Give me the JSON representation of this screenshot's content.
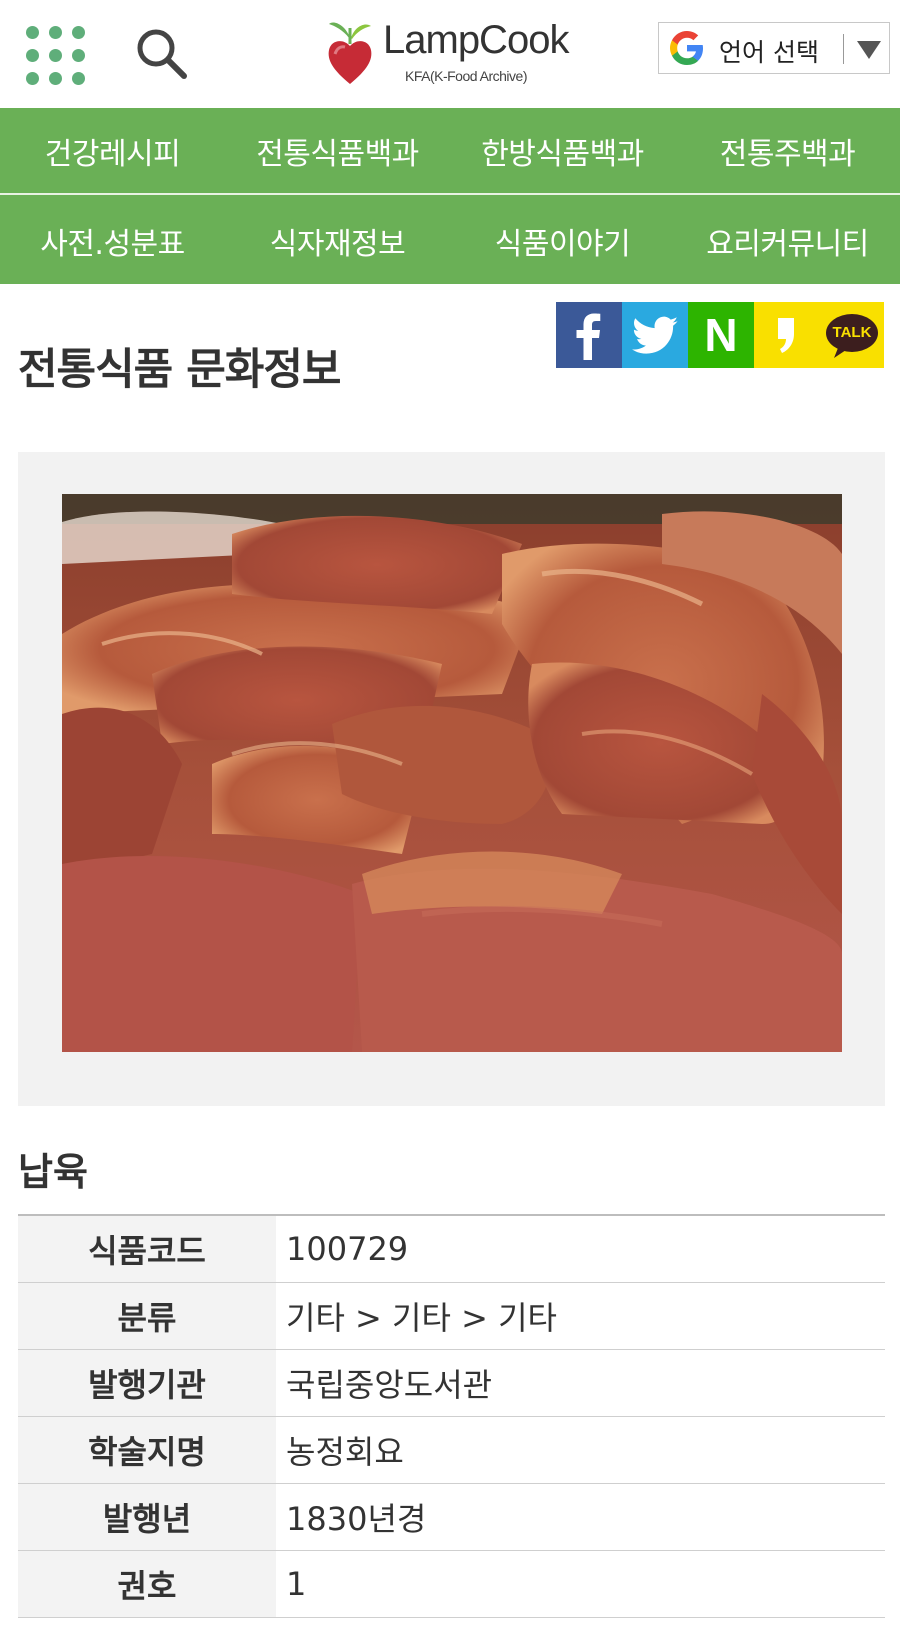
{
  "header": {
    "logo_text": "LampCook",
    "logo_subtitle": "KFA(K-Food Archive)",
    "language_button": "언어 선택"
  },
  "nav": {
    "row1": [
      "건강레시피",
      "전통식품백과",
      "한방식품백과",
      "전통주백과"
    ],
    "row2": [
      "사전.성분표",
      "식자재정보",
      "식품이야기",
      "요리커뮤니티"
    ]
  },
  "page": {
    "title": "전통식품 문화정보",
    "share_buttons": [
      "facebook-icon",
      "twitter-icon",
      "naver-icon",
      "kakaostory-icon",
      "kakaotalk-icon"
    ],
    "kakaotalk_label": "TALK",
    "naver_label": "N"
  },
  "food": {
    "name": "납육",
    "image_alt": "sliced cured pork",
    "rows": [
      {
        "label": "식품코드",
        "value": "100729"
      },
      {
        "label": "분류",
        "value": "기타 > 기타 > 기타"
      },
      {
        "label": "발행기관",
        "value": "국립중앙도서관"
      },
      {
        "label": "학술지명",
        "value": "농정회요"
      },
      {
        "label": "발행년",
        "value": "1830년경"
      },
      {
        "label": "권호",
        "value": "1"
      }
    ]
  },
  "colors": {
    "nav_green": "#6ab056",
    "facebook": "#3b5998",
    "twitter": "#2aa9e0",
    "naver": "#2db400",
    "kakao": "#f9e000"
  }
}
